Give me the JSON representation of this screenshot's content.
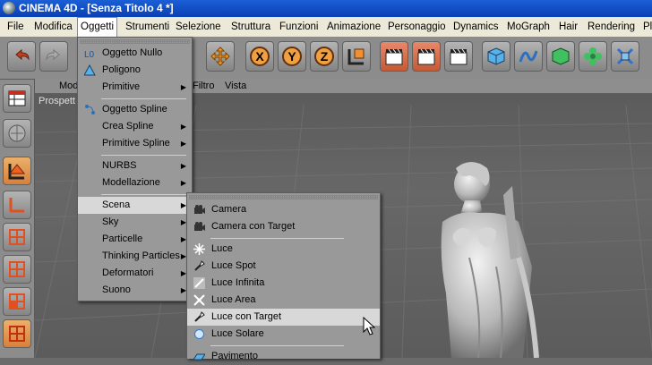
{
  "window": {
    "title": "CINEMA 4D - [Senza Titolo 4 *]"
  },
  "menubar": [
    "File",
    "Modifica",
    "Oggetti",
    "Strumenti",
    "Selezione",
    "Struttura",
    "Funzioni",
    "Animazione",
    "Personaggio",
    "Dynamics",
    "MoGraph",
    "Hair",
    "Rendering",
    "Pl"
  ],
  "viewport": {
    "menu": [
      "Mod",
      "Filtro",
      "Vista"
    ],
    "label": "Prospett"
  },
  "menu_oggetti": {
    "items": [
      {
        "label": "Oggetto Nullo",
        "icon": "null-object-icon"
      },
      {
        "label": "Poligono",
        "icon": "polygon-icon"
      },
      {
        "label": "Primitive",
        "submenu": true
      },
      {
        "label": "Oggetto Spline",
        "icon": "spline-object-icon"
      },
      {
        "label": "Crea Spline",
        "submenu": true
      },
      {
        "label": "Primitive Spline",
        "submenu": true
      },
      {
        "label": "NURBS",
        "submenu": true
      },
      {
        "label": "Modellazione",
        "submenu": true
      },
      {
        "label": "Scena",
        "submenu": true,
        "highlighted": true
      },
      {
        "label": "Sky",
        "submenu": true
      },
      {
        "label": "Particelle",
        "submenu": true
      },
      {
        "label": "Thinking Particles",
        "submenu": true
      },
      {
        "label": "Deformatori",
        "submenu": true
      },
      {
        "label": "Suono",
        "submenu": true
      }
    ]
  },
  "menu_scena": {
    "items": [
      {
        "label": "Camera",
        "icon": "camera-icon"
      },
      {
        "label": "Camera con Target",
        "icon": "target-camera-icon"
      },
      {
        "label": "Luce",
        "icon": "light-icon"
      },
      {
        "label": "Luce Spot",
        "icon": "spot-light-icon"
      },
      {
        "label": "Luce Infinita",
        "icon": "infinite-light-icon"
      },
      {
        "label": "Luce Area",
        "icon": "area-light-icon"
      },
      {
        "label": "Luce con Target",
        "icon": "target-light-icon",
        "highlighted": true
      },
      {
        "label": "Luce Solare",
        "icon": "sun-light-icon"
      },
      {
        "label": "Pavimento",
        "icon": "floor-icon"
      }
    ]
  },
  "colors": {
    "accent": "#e06d45",
    "menu_bg": "#999999",
    "highlight": "#d8d8d8",
    "titlebar": "#1b5fd6"
  }
}
